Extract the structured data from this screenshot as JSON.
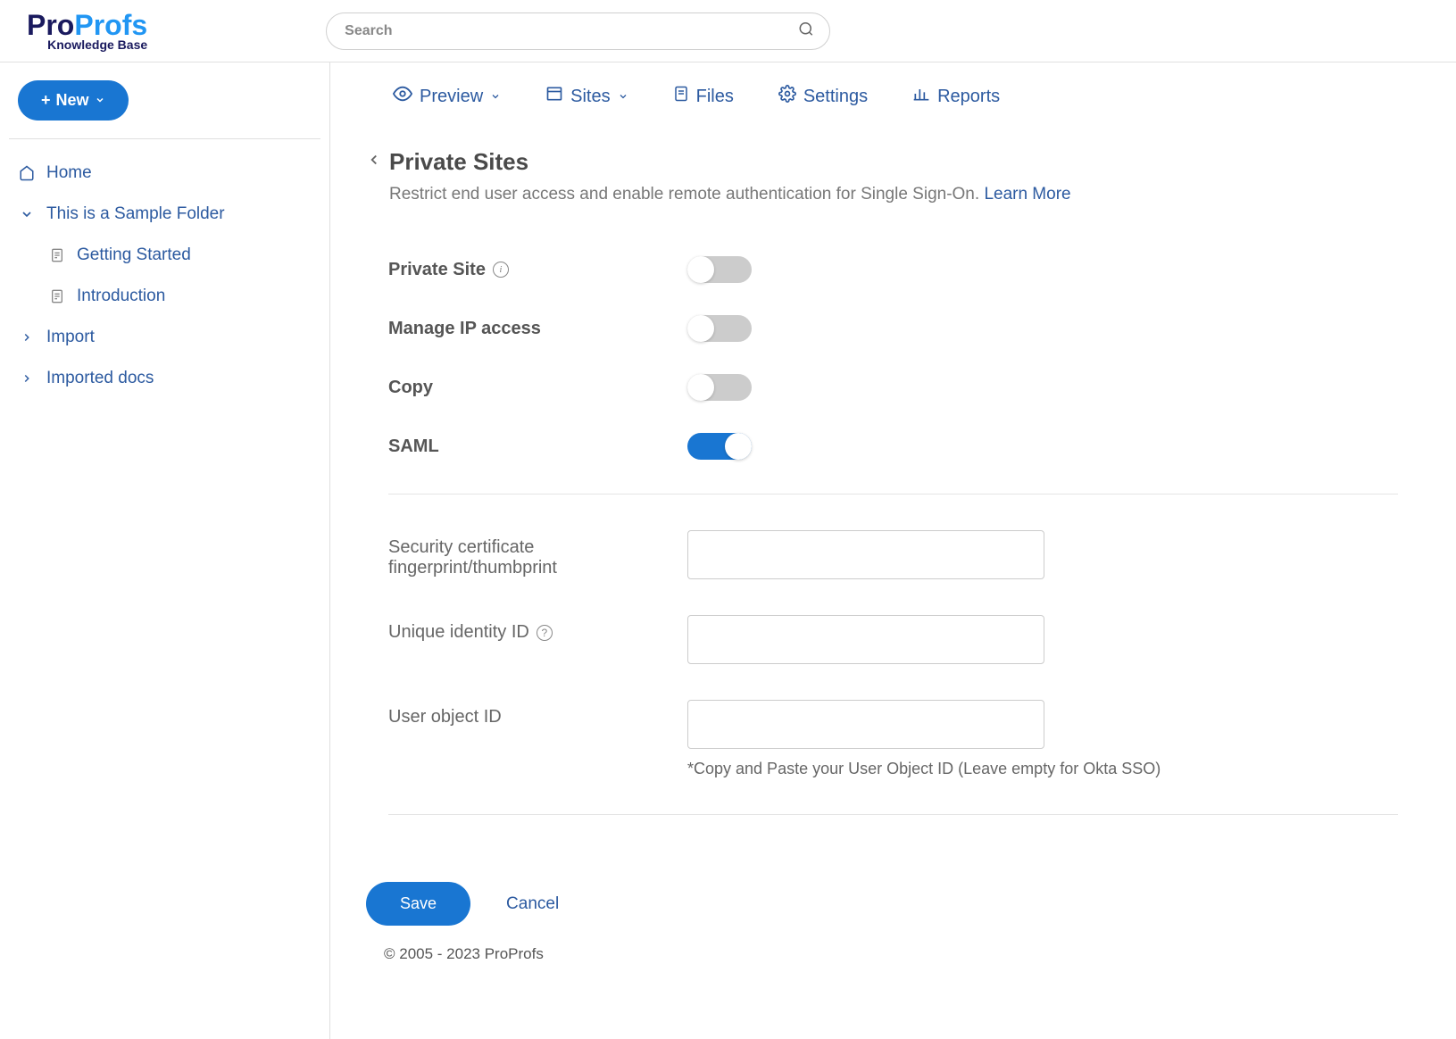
{
  "header": {
    "logo_pro": "Pro",
    "logo_profs": "Profs",
    "logo_sub": "Knowledge Base",
    "search_placeholder": "Search"
  },
  "sidebar": {
    "new_button": "New",
    "tree": {
      "home": "Home",
      "sample_folder": "This is a Sample Folder",
      "getting_started": "Getting Started",
      "introduction": "Introduction",
      "import": "Import",
      "imported_docs": "Imported docs"
    }
  },
  "topnav": {
    "preview": "Preview",
    "sites": "Sites",
    "files": "Files",
    "settings": "Settings",
    "reports": "Reports"
  },
  "page": {
    "title": "Private Sites",
    "subtitle": "Restrict end user access and enable remote authentication for Single Sign-On. ",
    "learn_more": "Learn More"
  },
  "toggles": {
    "private_site": {
      "label": "Private Site",
      "on": false
    },
    "manage_ip": {
      "label": "Manage IP access",
      "on": false
    },
    "copy": {
      "label": "Copy",
      "on": false
    },
    "saml": {
      "label": "SAML",
      "on": true
    }
  },
  "fields": {
    "cert": {
      "label": "Security certificate fingerprint/thumbprint",
      "value": ""
    },
    "unique_id": {
      "label": "Unique identity ID",
      "value": ""
    },
    "user_obj": {
      "label": "User object ID",
      "value": "",
      "hint": "*Copy and Paste your User Object ID (Leave empty for Okta SSO)"
    }
  },
  "buttons": {
    "save": "Save",
    "cancel": "Cancel"
  },
  "footer": "© 2005 - 2023 ProProfs"
}
